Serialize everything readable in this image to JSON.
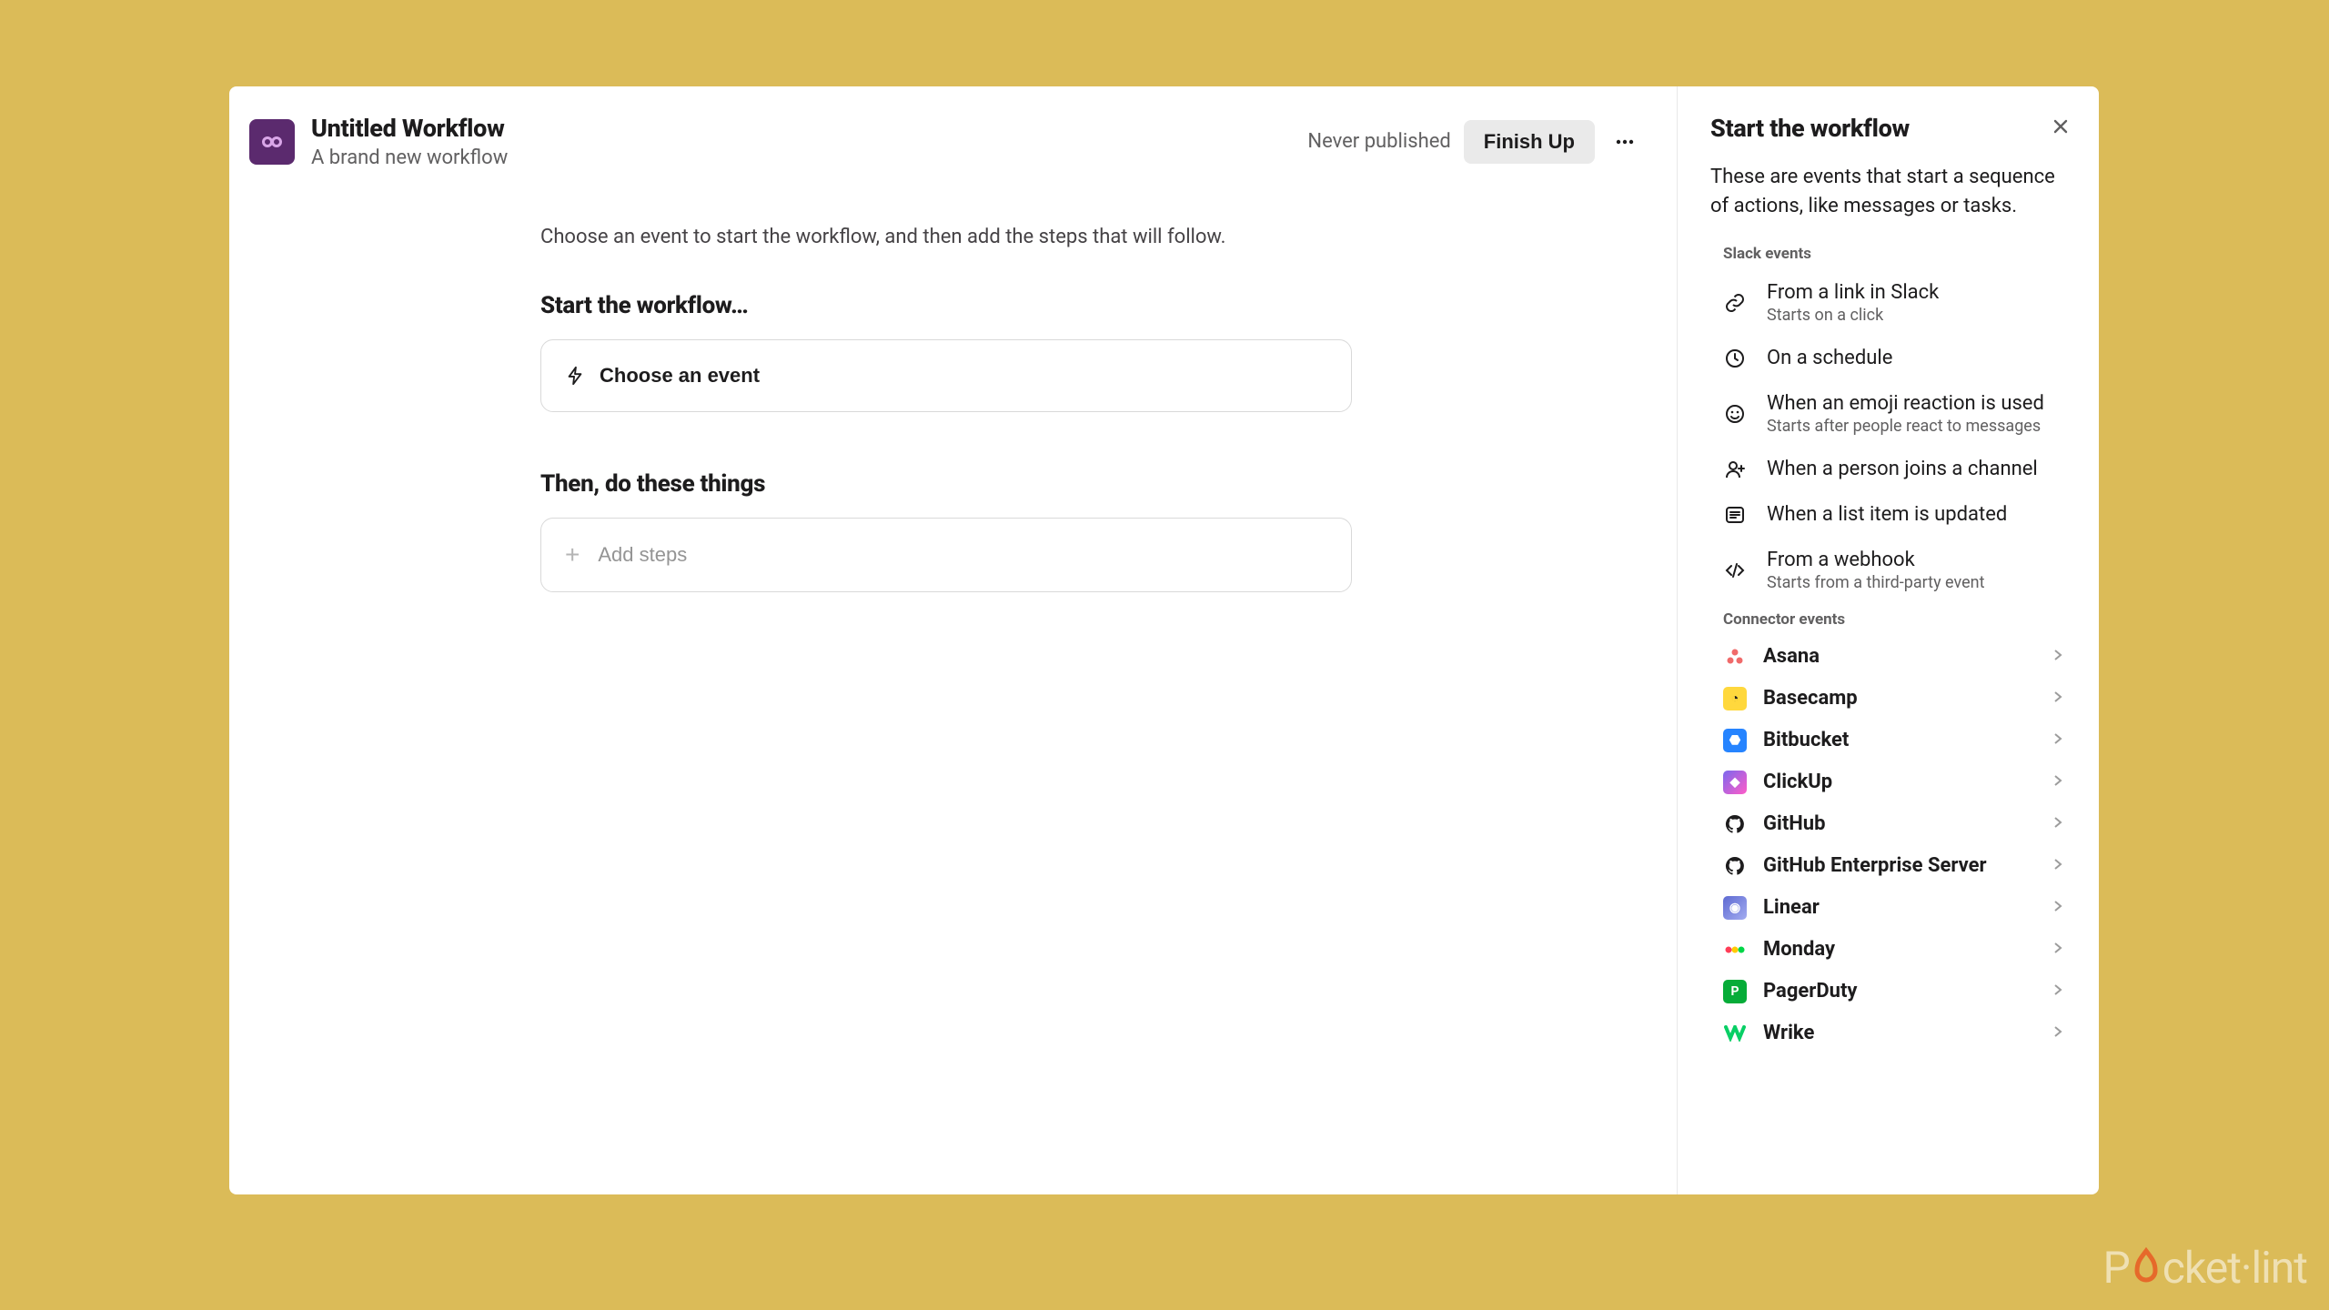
{
  "header": {
    "title": "Untitled Workflow",
    "subtitle": "A brand new workflow",
    "status": "Never published",
    "finish": "Finish Up"
  },
  "main": {
    "intro": "Choose an event to start the workflow, and then add the steps that will follow.",
    "start_heading": "Start the workflow…",
    "choose_event": "Choose an event",
    "then_heading": "Then, do these things",
    "add_steps": "Add steps"
  },
  "panel": {
    "title": "Start the workflow",
    "desc": "These are events that start a sequence of actions, like messages or tasks.",
    "slack_label": "Slack events",
    "connector_label": "Connector events",
    "events": [
      {
        "title": "From a link in Slack",
        "sub": "Starts on a click"
      },
      {
        "title": "On a schedule",
        "sub": ""
      },
      {
        "title": "When an emoji reaction is used",
        "sub": "Starts after people react to messages"
      },
      {
        "title": "When a person joins a channel",
        "sub": ""
      },
      {
        "title": "When a list item is updated",
        "sub": ""
      },
      {
        "title": "From a webhook",
        "sub": "Starts from a third-party event"
      }
    ],
    "connectors": [
      {
        "name": "Asana"
      },
      {
        "name": "Basecamp"
      },
      {
        "name": "Bitbucket"
      },
      {
        "name": "ClickUp"
      },
      {
        "name": "GitHub"
      },
      {
        "name": "GitHub Enterprise Server"
      },
      {
        "name": "Linear"
      },
      {
        "name": "Monday"
      },
      {
        "name": "PagerDuty"
      },
      {
        "name": "Wrike"
      }
    ]
  },
  "watermark": {
    "a": "P",
    "b": "cket·lint"
  }
}
